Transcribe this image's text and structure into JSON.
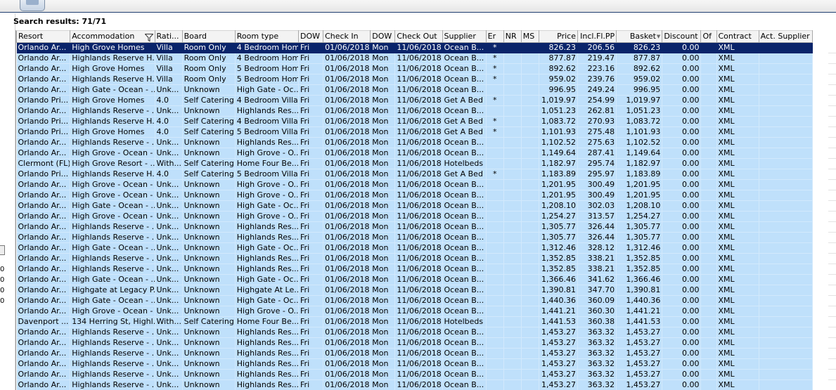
{
  "search": {
    "label": "Search results: 71/71"
  },
  "columns": [
    {
      "key": "resort",
      "label": "Resort",
      "w": 76
    },
    {
      "key": "accommodation",
      "label": "Accommodation",
      "w": 120
    },
    {
      "key": "rating",
      "label": "Rati...",
      "w": 39
    },
    {
      "key": "board",
      "label": "Board",
      "w": 75
    },
    {
      "key": "roomtype",
      "label": "Room type",
      "w": 90
    },
    {
      "key": "dow1",
      "label": "DOW",
      "w": 35
    },
    {
      "key": "checkin",
      "label": "Check In",
      "w": 67
    },
    {
      "key": "dow2",
      "label": "DOW",
      "w": 35
    },
    {
      "key": "checkout",
      "label": "Check Out",
      "w": 67
    },
    {
      "key": "supplier",
      "label": "Supplier",
      "w": 62
    },
    {
      "key": "er",
      "label": "Er",
      "w": 25
    },
    {
      "key": "nr",
      "label": "NR",
      "w": 25
    },
    {
      "key": "ms",
      "label": "MS",
      "w": 25
    },
    {
      "key": "price",
      "label": "Price",
      "w": 55
    },
    {
      "key": "inclflpp",
      "label": "Incl.Fl.PP",
      "w": 55
    },
    {
      "key": "basket",
      "label": "Basket",
      "w": 65
    },
    {
      "key": "discount",
      "label": "Discount",
      "w": 55
    },
    {
      "key": "of",
      "label": "Of",
      "w": 22
    },
    {
      "key": "contract",
      "label": "Contract",
      "w": 60
    },
    {
      "key": "actsupplier",
      "label": "Act. Supplier",
      "w": 76
    }
  ],
  "rows": [
    [
      "Orlando Ar...",
      "High Grove Homes",
      "Villa",
      "Room Only",
      "4 Bedroom Home",
      "Fri",
      "01/06/2018",
      "Mon",
      "11/06/2018",
      "Ocean B...",
      "*",
      "",
      "",
      "826.23",
      "206.56",
      "826.23",
      "0.00",
      "",
      "XML",
      ""
    ],
    [
      "Orlando Ar...",
      "Highlands Reserve H...",
      "Villa",
      "Room Only",
      "4 Bedroom Home",
      "Fri",
      "01/06/2018",
      "Mon",
      "11/06/2018",
      "Ocean B...",
      "*",
      "",
      "",
      "877.87",
      "219.47",
      "877.87",
      "0.00",
      "",
      "XML",
      ""
    ],
    [
      "Orlando Ar...",
      "High Grove Homes",
      "Villa",
      "Room Only",
      "5 Bedroom Home",
      "Fri",
      "01/06/2018",
      "Mon",
      "11/06/2018",
      "Ocean B...",
      "*",
      "",
      "",
      "892.62",
      "223.16",
      "892.62",
      "0.00",
      "",
      "XML",
      ""
    ],
    [
      "Orlando Ar...",
      "Highlands Reserve H...",
      "Villa",
      "Room Only",
      "5 Bedroom Home",
      "Fri",
      "01/06/2018",
      "Mon",
      "11/06/2018",
      "Ocean B...",
      "*",
      "",
      "",
      "959.02",
      "239.76",
      "959.02",
      "0.00",
      "",
      "XML",
      ""
    ],
    [
      "Orlando Ar...",
      "High Gate - Ocean - ...",
      "Unk...",
      "Unknown",
      "High Gate - Oc...",
      "Fri",
      "01/06/2018",
      "Mon",
      "11/06/2018",
      "Ocean B...",
      "",
      "",
      "",
      "996.95",
      "249.24",
      "996.95",
      "0.00",
      "",
      "XML",
      ""
    ],
    [
      "Orlando Pri...",
      "High Grove Homes",
      "4.0",
      "Self Catering",
      "4 Bedroom Villa...",
      "Fri",
      "01/06/2018",
      "Mon",
      "11/06/2018",
      "Get A Bed",
      "*",
      "",
      "",
      "1,019.97",
      "254.99",
      "1,019.97",
      "0.00",
      "",
      "XML",
      ""
    ],
    [
      "Orlando Ar...",
      "Highlands Reserve - ...",
      "Unk...",
      "Unknown",
      "Highlands Res...",
      "Fri",
      "01/06/2018",
      "Mon",
      "11/06/2018",
      "Ocean B...",
      "",
      "",
      "",
      "1,051.23",
      "262.81",
      "1,051.23",
      "0.00",
      "",
      "XML",
      ""
    ],
    [
      "Orlando Pri...",
      "Highlands Reserve H...",
      "4.0",
      "Self Catering",
      "4 Bedroom Villa...",
      "Fri",
      "01/06/2018",
      "Mon",
      "11/06/2018",
      "Get A Bed",
      "*",
      "",
      "",
      "1,083.72",
      "270.93",
      "1,083.72",
      "0.00",
      "",
      "XML",
      ""
    ],
    [
      "Orlando Pri...",
      "High Grove Homes",
      "4.0",
      "Self Catering",
      "5 Bedroom Villa...",
      "Fri",
      "01/06/2018",
      "Mon",
      "11/06/2018",
      "Get A Bed",
      "*",
      "",
      "",
      "1,101.93",
      "275.48",
      "1,101.93",
      "0.00",
      "",
      "XML",
      ""
    ],
    [
      "Orlando Ar...",
      "Highlands Reserve - ...",
      "Unk...",
      "Unknown",
      "Highlands Res...",
      "Fri",
      "01/06/2018",
      "Mon",
      "11/06/2018",
      "Ocean B...",
      "",
      "",
      "",
      "1,102.52",
      "275.63",
      "1,102.52",
      "0.00",
      "",
      "XML",
      ""
    ],
    [
      "Orlando Ar...",
      "High Grove - Ocean - ...",
      "Unk...",
      "Unknown",
      "High Grove - O...",
      "Fri",
      "01/06/2018",
      "Mon",
      "11/06/2018",
      "Ocean B...",
      "",
      "",
      "",
      "1,149.64",
      "287.41",
      "1,149.64",
      "0.00",
      "",
      "XML",
      ""
    ],
    [
      "Clermont (FL)",
      "High Grove Resort - ...",
      "With...",
      "Self Catering",
      "Home Four Be...",
      "Fri",
      "01/06/2018",
      "Mon",
      "11/06/2018",
      "Hotelbeds",
      "",
      "",
      "",
      "1,182.97",
      "295.74",
      "1,182.97",
      "0.00",
      "",
      "XML",
      ""
    ],
    [
      "Orlando Pri...",
      "Highlands Reserve H...",
      "4.0",
      "Self Catering",
      "5 Bedroom Villa...",
      "Fri",
      "01/06/2018",
      "Mon",
      "11/06/2018",
      "Get A Bed",
      "*",
      "",
      "",
      "1,183.89",
      "295.97",
      "1,183.89",
      "0.00",
      "",
      "XML",
      ""
    ],
    [
      "Orlando Ar...",
      "High Grove - Ocean - ...",
      "Unk...",
      "Unknown",
      "High Grove - O...",
      "Fri",
      "01/06/2018",
      "Mon",
      "11/06/2018",
      "Ocean B...",
      "",
      "",
      "",
      "1,201.95",
      "300.49",
      "1,201.95",
      "0.00",
      "",
      "XML",
      ""
    ],
    [
      "Orlando Ar...",
      "High Grove - Ocean - ...",
      "Unk...",
      "Unknown",
      "High Grove - O...",
      "Fri",
      "01/06/2018",
      "Mon",
      "11/06/2018",
      "Ocean B...",
      "",
      "",
      "",
      "1,201.95",
      "300.49",
      "1,201.95",
      "0.00",
      "",
      "XML",
      ""
    ],
    [
      "Orlando Ar...",
      "High Gate - Ocean - ...",
      "Unk...",
      "Unknown",
      "High Gate - Oc...",
      "Fri",
      "01/06/2018",
      "Mon",
      "11/06/2018",
      "Ocean B...",
      "",
      "",
      "",
      "1,208.10",
      "302.03",
      "1,208.10",
      "0.00",
      "",
      "XML",
      ""
    ],
    [
      "Orlando Ar...",
      "High Grove - Ocean - ...",
      "Unk...",
      "Unknown",
      "High Grove - O...",
      "Fri",
      "01/06/2018",
      "Mon",
      "11/06/2018",
      "Ocean B...",
      "",
      "",
      "",
      "1,254.27",
      "313.57",
      "1,254.27",
      "0.00",
      "",
      "XML",
      ""
    ],
    [
      "Orlando Ar...",
      "Highlands Reserve - ...",
      "Unk...",
      "Unknown",
      "Highlands Res...",
      "Fri",
      "01/06/2018",
      "Mon",
      "11/06/2018",
      "Ocean B...",
      "",
      "",
      "",
      "1,305.77",
      "326.44",
      "1,305.77",
      "0.00",
      "",
      "XML",
      ""
    ],
    [
      "Orlando Ar...",
      "Highlands Reserve - ...",
      "Unk...",
      "Unknown",
      "Highlands Res...",
      "Fri",
      "01/06/2018",
      "Mon",
      "11/06/2018",
      "Ocean B...",
      "",
      "",
      "",
      "1,305.77",
      "326.44",
      "1,305.77",
      "0.00",
      "",
      "XML",
      ""
    ],
    [
      "Orlando Ar...",
      "High Gate - Ocean - ...",
      "Unk...",
      "Unknown",
      "High Gate - Oc...",
      "Fri",
      "01/06/2018",
      "Mon",
      "11/06/2018",
      "Ocean B...",
      "",
      "",
      "",
      "1,312.46",
      "328.12",
      "1,312.46",
      "0.00",
      "",
      "XML",
      ""
    ],
    [
      "Orlando Ar...",
      "Highlands Reserve - ...",
      "Unk...",
      "Unknown",
      "Highlands Res...",
      "Fri",
      "01/06/2018",
      "Mon",
      "11/06/2018",
      "Ocean B...",
      "",
      "",
      "",
      "1,352.85",
      "338.21",
      "1,352.85",
      "0.00",
      "",
      "XML",
      ""
    ],
    [
      "Orlando Ar...",
      "Highlands Reserve - ...",
      "Unk...",
      "Unknown",
      "Highlands Res...",
      "Fri",
      "01/06/2018",
      "Mon",
      "11/06/2018",
      "Ocean B...",
      "",
      "",
      "",
      "1,352.85",
      "338.21",
      "1,352.85",
      "0.00",
      "",
      "XML",
      ""
    ],
    [
      "Orlando Ar...",
      "High Gate - Ocean - ...",
      "Unk...",
      "Unknown",
      "High Gate - Oc...",
      "Fri",
      "01/06/2018",
      "Mon",
      "11/06/2018",
      "Ocean B...",
      "",
      "",
      "",
      "1,366.46",
      "341.62",
      "1,366.46",
      "0.00",
      "",
      "XML",
      ""
    ],
    [
      "Orlando Ar...",
      "Highgate at Legacy P...",
      "Unk...",
      "Unknown",
      "Highgate At Le...",
      "Fri",
      "01/06/2018",
      "Mon",
      "11/06/2018",
      "Ocean B...",
      "",
      "",
      "",
      "1,390.81",
      "347.70",
      "1,390.81",
      "0.00",
      "",
      "XML",
      ""
    ],
    [
      "Orlando Ar...",
      "High Gate - Ocean - ...",
      "Unk...",
      "Unknown",
      "High Gate - Oc...",
      "Fri",
      "01/06/2018",
      "Mon",
      "11/06/2018",
      "Ocean B...",
      "",
      "",
      "",
      "1,440.36",
      "360.09",
      "1,440.36",
      "0.00",
      "",
      "XML",
      ""
    ],
    [
      "Orlando Ar...",
      "High Grove - Ocean - ...",
      "Unk...",
      "Unknown",
      "High Grove - O...",
      "Fri",
      "01/06/2018",
      "Mon",
      "11/06/2018",
      "Ocean B...",
      "",
      "",
      "",
      "1,441.21",
      "360.30",
      "1,441.21",
      "0.00",
      "",
      "XML",
      ""
    ],
    [
      "Davenport ...",
      "134 Herring St, Highl...",
      "With...",
      "Self Catering",
      "Home Four Be...",
      "Fri",
      "01/06/2018",
      "Mon",
      "11/06/2018",
      "Hotelbeds",
      "",
      "",
      "",
      "1,441.53",
      "360.38",
      "1,441.53",
      "0.00",
      "",
      "XML",
      ""
    ],
    [
      "Orlando Ar...",
      "Highlands Reserve - ...",
      "Unk...",
      "Unknown",
      "Highlands Res...",
      "Fri",
      "01/06/2018",
      "Mon",
      "11/06/2018",
      "Ocean B...",
      "",
      "",
      "",
      "1,453.27",
      "363.32",
      "1,453.27",
      "0.00",
      "",
      "XML",
      ""
    ],
    [
      "Orlando Ar...",
      "Highlands Reserve - ...",
      "Unk...",
      "Unknown",
      "Highlands Res...",
      "Fri",
      "01/06/2018",
      "Mon",
      "11/06/2018",
      "Ocean B...",
      "",
      "",
      "",
      "1,453.27",
      "363.32",
      "1,453.27",
      "0.00",
      "",
      "XML",
      ""
    ],
    [
      "Orlando Ar...",
      "Highlands Reserve - ...",
      "Unk...",
      "Unknown",
      "Highlands Res...",
      "Fri",
      "01/06/2018",
      "Mon",
      "11/06/2018",
      "Ocean B...",
      "",
      "",
      "",
      "1,453.27",
      "363.32",
      "1,453.27",
      "0.00",
      "",
      "XML",
      ""
    ],
    [
      "Orlando Ar...",
      "Highlands Reserve - ...",
      "Unk...",
      "Unknown",
      "Highlands Res...",
      "Fri",
      "01/06/2018",
      "Mon",
      "11/06/2018",
      "Ocean B...",
      "",
      "",
      "",
      "1,453.27",
      "363.32",
      "1,453.27",
      "0.00",
      "",
      "XML",
      ""
    ],
    [
      "Orlando Ar...",
      "Highlands Reserve - ...",
      "Unk...",
      "Unknown",
      "Highlands Res...",
      "Fri",
      "01/06/2018",
      "Mon",
      "11/06/2018",
      "Ocean B...",
      "",
      "",
      "",
      "1,453.27",
      "363.32",
      "1,453.27",
      "0.00",
      "",
      "XML",
      ""
    ],
    [
      "Orlando Ar...",
      "Highlands Reserve - ...",
      "Unk...",
      "Unknown",
      "Highlands Res...",
      "Fri",
      "01/06/2018",
      "Mon",
      "11/06/2018",
      "Ocean B...",
      "",
      "",
      "",
      "1,453.27",
      "363.32",
      "1,453.27",
      "0.00",
      "",
      "XML",
      ""
    ]
  ],
  "selected_row": 0,
  "left_stubs": [
    "0",
    "0",
    "0",
    "0"
  ],
  "icons": {
    "filter": "filter-icon",
    "sort": "sort-desc-icon",
    "app": "app-icon"
  },
  "colors": {
    "row_bg": "#bfe0fb",
    "selected_bg": "#0a246a",
    "selected_fg": "#ffffff",
    "header_bg": "#f3f3f3"
  }
}
